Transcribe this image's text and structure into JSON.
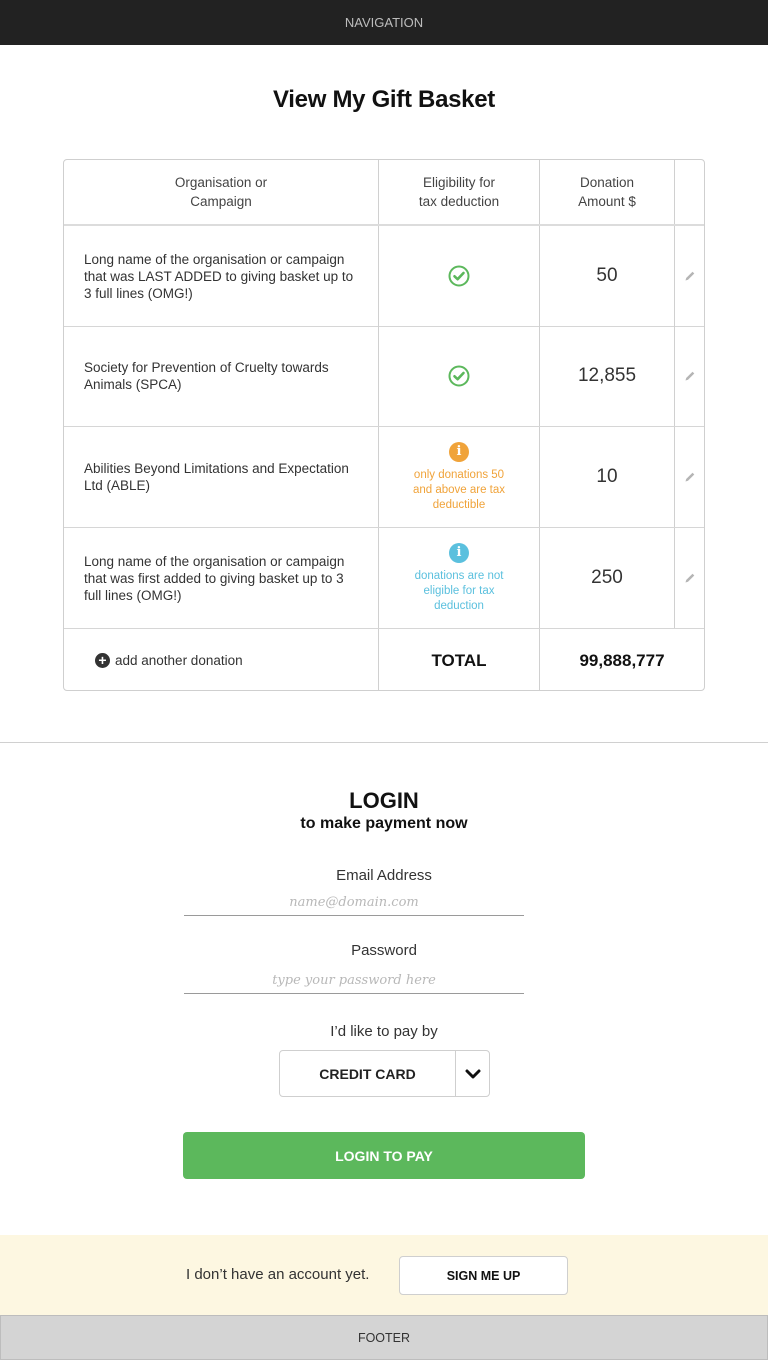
{
  "navigation": {
    "label": "NAVIGATION"
  },
  "page": {
    "title": "View My Gift Basket"
  },
  "basket": {
    "headers": {
      "col1_line1": "Organisation or",
      "col1_line2": "Campaign",
      "col2_line1": "Eligibility for",
      "col2_line2": "tax deduction",
      "col3_line1": "Donation",
      "col3_line2": "Amount $"
    },
    "rows": [
      {
        "name": "Long name of the organisation or campaign that was LAST ADDED to giving basket up to 3 full lines (OMG!)",
        "eligibility": "eligible",
        "icon": "check-circle-icon",
        "amount": "50"
      },
      {
        "name": "Society for Prevention of Cruelty towards Animals (SPCA)",
        "eligibility": "eligible",
        "icon": "check-circle-icon",
        "amount": "12,855"
      },
      {
        "name": "Abilities Beyond Limitations and Expectation Ltd (ABLE)",
        "eligibility": "partial",
        "icon": "info-icon",
        "note": "only donations 50 and above are tax deductible",
        "color": "#f0a33a",
        "amount": "10"
      },
      {
        "name": "Long name of the organisation or campaign that was first added to giving basket up to 3 full lines (OMG!)",
        "eligibility": "not-eligible",
        "icon": "info-icon",
        "note": "donations are not eligible for tax deduction",
        "color": "#5bc0de",
        "amount": "250"
      }
    ],
    "add_label": "add another donation",
    "total_label": "TOTAL",
    "total_value": "99,888,777"
  },
  "login": {
    "title": "LOGIN",
    "subtitle": "to make payment now",
    "email_label": "Email Address",
    "email_placeholder": "name@domain.com",
    "password_label": "Password",
    "password_placeholder": "type your password here",
    "pay_label": "I’d like to pay by",
    "pay_method": "CREDIT CARD",
    "submit_label": "LOGIN TO PAY"
  },
  "signup": {
    "text": "I don’t have an account yet.",
    "button_label": "SIGN ME UP"
  },
  "footer": {
    "label": "FOOTER"
  },
  "colors": {
    "success": "#5cb85c",
    "warning": "#f0a33a",
    "info": "#5bc0de",
    "nav_bg": "#222222",
    "signup_bg": "#fdf7e1"
  }
}
